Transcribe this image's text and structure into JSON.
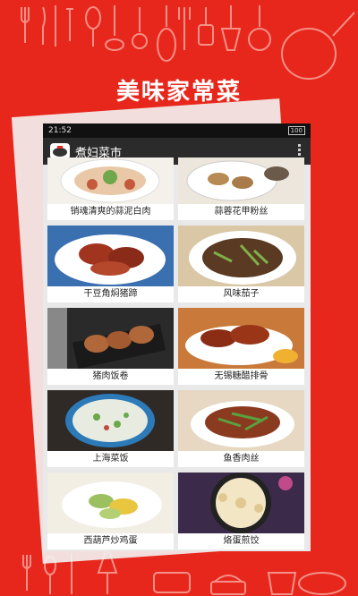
{
  "promo": {
    "headline": "美味家常菜"
  },
  "status_bar": {
    "time": "21:52",
    "battery": "100"
  },
  "app_bar": {
    "title": "煮妇菜市"
  },
  "recipes": [
    {
      "name": "销魂清爽的蒜泥白肉"
    },
    {
      "name": "蒜蓉花甲粉丝"
    },
    {
      "name": "干豆角焖猪蹄"
    },
    {
      "name": "风味茄子"
    },
    {
      "name": "猪肉饭卷"
    },
    {
      "name": "无锡糖醋排骨"
    },
    {
      "name": "上海菜饭"
    },
    {
      "name": "鱼香肉丝"
    },
    {
      "name": "西葫芦炒鸡蛋"
    },
    {
      "name": "烙蛋煎饺"
    }
  ],
  "colors": {
    "background": "#e8271c",
    "appbar": "#2b2b2b"
  }
}
